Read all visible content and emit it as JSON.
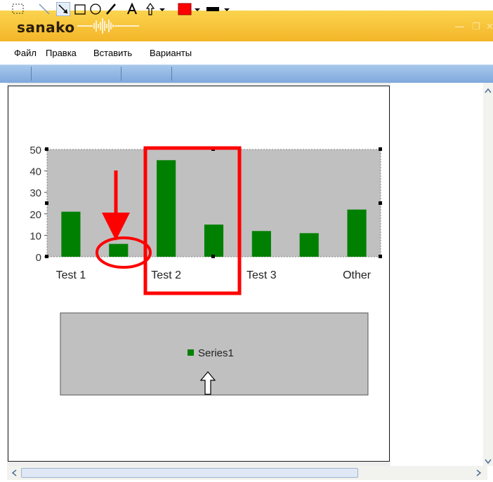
{
  "app": {
    "logo": "sanako"
  },
  "menu": {
    "items": [
      "Файл",
      "Правка",
      "Вставить",
      "Варианты"
    ]
  },
  "toolbar": {
    "tools": [
      "select-rect",
      "line",
      "arrow",
      "rectangle",
      "ellipse",
      "pen",
      "text",
      "pointer"
    ],
    "colors": {
      "fill": "#ff0000",
      "line": "#000000",
      "accent": "#7ea8dc"
    }
  },
  "chart_data": {
    "type": "bar",
    "categories": [
      "Test 1",
      "",
      "Test 2",
      "",
      "Test 3",
      "",
      "Other"
    ],
    "tick_labels": [
      "Test 1",
      "Test 2",
      "Test 3",
      "Other"
    ],
    "series": [
      {
        "name": "Series1",
        "values": [
          21,
          6,
          45,
          15,
          12,
          11,
          22
        ],
        "color": "#008000"
      }
    ],
    "yticks": [
      "0",
      "10",
      "20",
      "30",
      "40",
      "50"
    ],
    "ylim": [
      0,
      50
    ],
    "grid": false,
    "legend": "bottom",
    "plot_background": "#c0c0c0"
  },
  "annotations": {
    "arrow_color": "#ff0000",
    "ellipse_color": "#ff0000",
    "box_color": "#ff0000"
  }
}
